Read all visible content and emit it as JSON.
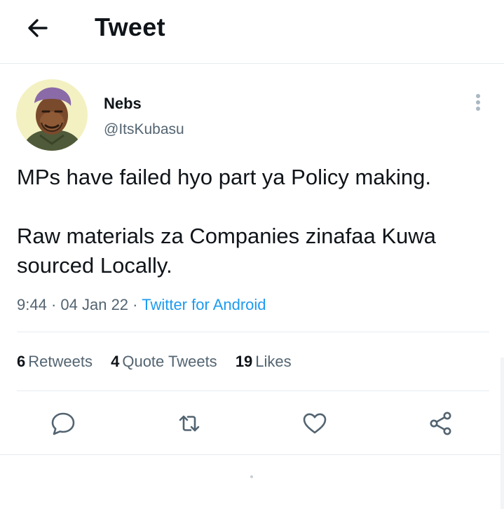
{
  "header": {
    "title": "Tweet",
    "back_icon": "arrow-left-icon"
  },
  "tweet": {
    "author_name": "Nebs",
    "author_handle": "@ItsKubasu",
    "text_lines": [
      "MPs have failed hyo part ya Policy making.",
      "",
      "Raw materials za Companies zinafaa Kuwa sourced Locally."
    ],
    "time": "9:44",
    "date": "04 Jan 22",
    "separator": "·",
    "source": "Twitter for Android"
  },
  "stats": {
    "retweets_count": "6",
    "retweets_label": "Retweets",
    "quotes_count": "4",
    "quotes_label": "Quote Tweets",
    "likes_count": "19",
    "likes_label": "Likes"
  },
  "actions": [
    "reply-icon",
    "retweet-icon",
    "like-icon",
    "share-icon"
  ],
  "colors": {
    "link": "#1d9bf0",
    "secondary_text": "#536471",
    "divider": "#e6ecf0",
    "icon": "#536471"
  }
}
